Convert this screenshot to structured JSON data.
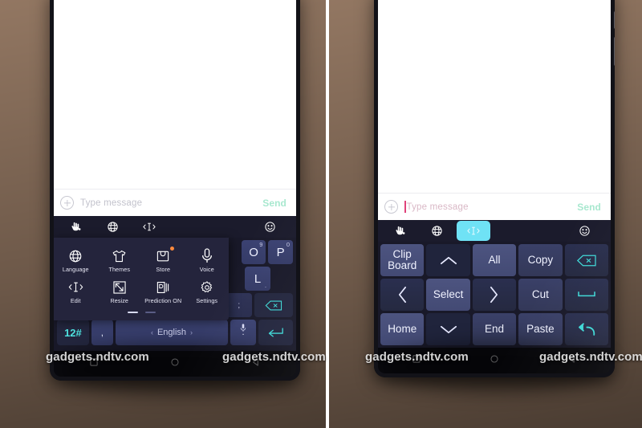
{
  "watermark": {
    "text": "gadgets.ndtv.com"
  },
  "left_phone": {
    "compose": {
      "placeholder": "Type message",
      "send_label": "Send",
      "add_icon": "plus-circle-icon"
    },
    "keyboard_toolbar": [
      {
        "name": "touch-hand-icon",
        "label": "hand"
      },
      {
        "name": "globe-icon",
        "label": "globe"
      },
      {
        "name": "text-cursor-icon",
        "label": "edit cursor"
      },
      {
        "name": "emoji-icon",
        "label": "emoji"
      }
    ],
    "menu": {
      "items": [
        {
          "label": "Language",
          "icon": "globe-icon",
          "badge": false
        },
        {
          "label": "Themes",
          "icon": "tshirt-icon",
          "badge": false
        },
        {
          "label": "Store",
          "icon": "shopping-bag-icon",
          "badge": true
        },
        {
          "label": "Voice",
          "icon": "microphone-icon",
          "badge": false
        },
        {
          "label": "Edit",
          "icon": "text-cursor-icon",
          "badge": false
        },
        {
          "label": "Resize",
          "icon": "resize-arrow-icon",
          "badge": false
        },
        {
          "label": "Prediction ON",
          "icon": "prediction-icon",
          "badge": false
        },
        {
          "label": "Settings",
          "icon": "gear-icon",
          "badge": false
        }
      ],
      "pages": {
        "count": 2,
        "active": 1
      }
    },
    "keys": {
      "row_letters": [
        {
          "label": "O",
          "sup": "9"
        },
        {
          "label": "P",
          "sup": "0"
        }
      ],
      "row_l": {
        "label": "L",
        "sub": "."
      },
      "backspace": "backspace-icon",
      "symbols_row": [
        "@",
        "/",
        "-",
        "'",
        "!",
        "?",
        ";"
      ],
      "bottom_row": {
        "numeric": "12#",
        "comma": ",",
        "space_label": "English",
        "space_left_arrow": "‹",
        "space_right_arrow": "›",
        "space_mic": "microphone-icon",
        "period": ".",
        "enter": "enter-icon"
      }
    },
    "navbar": [
      {
        "name": "recents-button",
        "icon": "square-icon"
      },
      {
        "name": "home-button",
        "icon": "circle-icon"
      },
      {
        "name": "back-button",
        "icon": "triangle-icon"
      }
    ]
  },
  "right_phone": {
    "compose": {
      "placeholder": "Type message",
      "send_label": "Send",
      "add_icon": "plus-circle-icon",
      "caret_visible": true
    },
    "keyboard_toolbar": [
      {
        "name": "touch-hand-icon",
        "label": "hand",
        "active": false
      },
      {
        "name": "globe-icon",
        "label": "globe",
        "active": false
      },
      {
        "name": "text-cursor-icon",
        "label": "edit cursor",
        "active": true
      },
      {
        "name": "emoji-icon",
        "label": "emoji",
        "active": false
      }
    ],
    "edit_panel": {
      "rows": [
        [
          {
            "label": "Clip\nBoard",
            "style": "lite",
            "name": "clipboard-key"
          },
          {
            "label": "",
            "icon": "chevron-up-icon",
            "style": "plain",
            "name": "cursor-up-key"
          },
          {
            "label": "All",
            "style": "lite",
            "name": "select-all-key"
          },
          {
            "label": "Copy",
            "style": "mid",
            "name": "copy-key"
          },
          {
            "label": "",
            "icon": "backspace-icon",
            "style": "dark",
            "name": "backspace-key"
          }
        ],
        [
          {
            "label": "",
            "icon": "chevron-left-icon",
            "style": "dark",
            "name": "cursor-left-key"
          },
          {
            "label": "Select",
            "style": "lite",
            "name": "select-key"
          },
          {
            "label": "",
            "icon": "chevron-right-icon",
            "style": "dark",
            "name": "cursor-right-key"
          },
          {
            "label": "Cut",
            "style": "mid",
            "name": "cut-key"
          },
          {
            "label": "",
            "icon": "space-icon",
            "style": "dark",
            "name": "space-key"
          }
        ],
        [
          {
            "label": "Home",
            "style": "lite",
            "name": "home-key"
          },
          {
            "label": "",
            "icon": "chevron-down-icon",
            "style": "plain",
            "name": "cursor-down-key"
          },
          {
            "label": "End",
            "style": "mid",
            "name": "end-key"
          },
          {
            "label": "Paste",
            "style": "mid",
            "name": "paste-key"
          },
          {
            "label": "",
            "icon": "enter-icon",
            "style": "dark",
            "name": "enter-key"
          }
        ]
      ]
    },
    "navbar": [
      {
        "name": "recents-button",
        "icon": "square-icon"
      },
      {
        "name": "home-button",
        "icon": "circle-icon"
      },
      {
        "name": "back-button",
        "icon": "triangle-icon"
      }
    ]
  },
  "colors": {
    "accent_cyan": "#6fe2f5",
    "keyboard_bg": "#191929",
    "menu_bg": "#24243c",
    "key_light": "#4d5480",
    "badge_orange": "#ff8a3d",
    "send_green": "#a8e8cf",
    "caret_pink": "#e0427a"
  }
}
